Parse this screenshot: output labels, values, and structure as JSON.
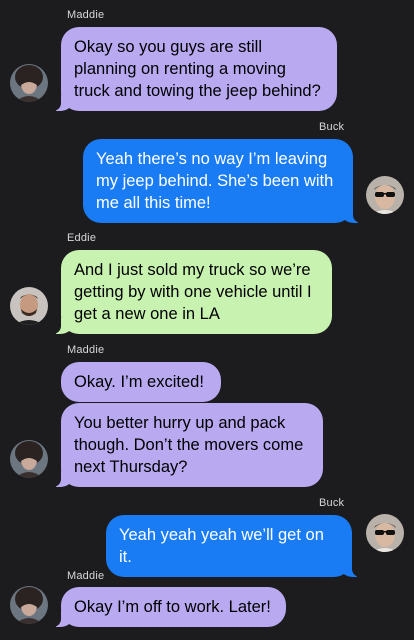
{
  "conversation": {
    "messages": [
      {
        "sender": "Maddie",
        "text": "Okay so you guys are still planning on renting a moving truck and towing the jeep behind?"
      },
      {
        "sender": "Buck",
        "text": "Yeah there’s no way I’m leaving my jeep behind. She’s been with me all this time!"
      },
      {
        "sender": "Eddie",
        "text": "And I just sold my truck so we’re getting by with one vehicle until I get a new one in LA"
      },
      {
        "sender": "Maddie",
        "text": "Okay. I’m excited!"
      },
      {
        "sender": "Maddie",
        "text": "You better hurry up and pack though. Don’t the movers come next Thursday?"
      },
      {
        "sender": "Buck",
        "text": "Yeah yeah yeah we’ll get on it."
      },
      {
        "sender": "Maddie",
        "text": "Okay I’m off to work. Later!"
      }
    ]
  },
  "colors": {
    "background": "#1c1c1e",
    "maddie_bubble": "#b8a9f0",
    "eddie_bubble": "#c8f2b0",
    "buck_bubble": "#1a7cf5"
  }
}
